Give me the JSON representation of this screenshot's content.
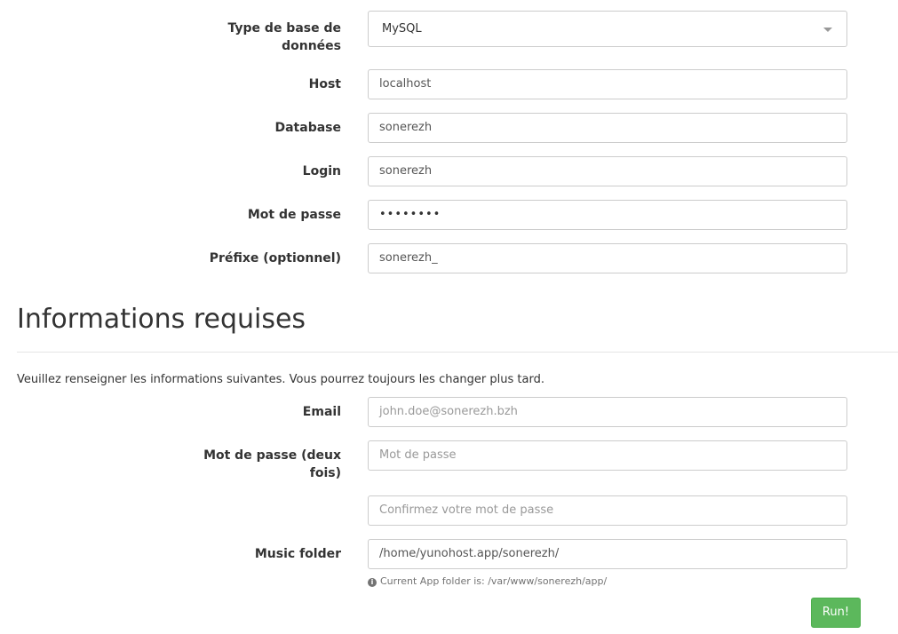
{
  "database": {
    "type_label": "Type de base de données",
    "type_value": "MySQL",
    "host_label": "Host",
    "host_value": "localhost",
    "database_label": "Database",
    "database_value": "sonerezh",
    "login_label": "Login",
    "login_value": "sonerezh",
    "password_label": "Mot de passe",
    "password_value": "••••••••",
    "prefix_label": "Préfixe (optionnel)",
    "prefix_value": "sonerezh_"
  },
  "required": {
    "heading": "Informations requises",
    "intro": "Veuillez renseigner les informations suivantes. Vous pourrez toujours les changer plus tard.",
    "email_label": "Email",
    "email_placeholder": "john.doe@sonerezh.bzh",
    "password_label": "Mot de passe (deux fois)",
    "password_placeholder": "Mot de passe",
    "confirm_placeholder": "Confirmez votre mot de passe",
    "music_label": "Music folder",
    "music_value": "/home/yunohost.app/sonerezh/",
    "help_text": "Current App folder is: /var/www/sonerezh/app/",
    "help_icon": "info-circle-icon"
  },
  "actions": {
    "run_label": "Run!"
  },
  "colors": {
    "run_button": "#5cb85c",
    "text": "#333333",
    "border": "#cccccc"
  }
}
